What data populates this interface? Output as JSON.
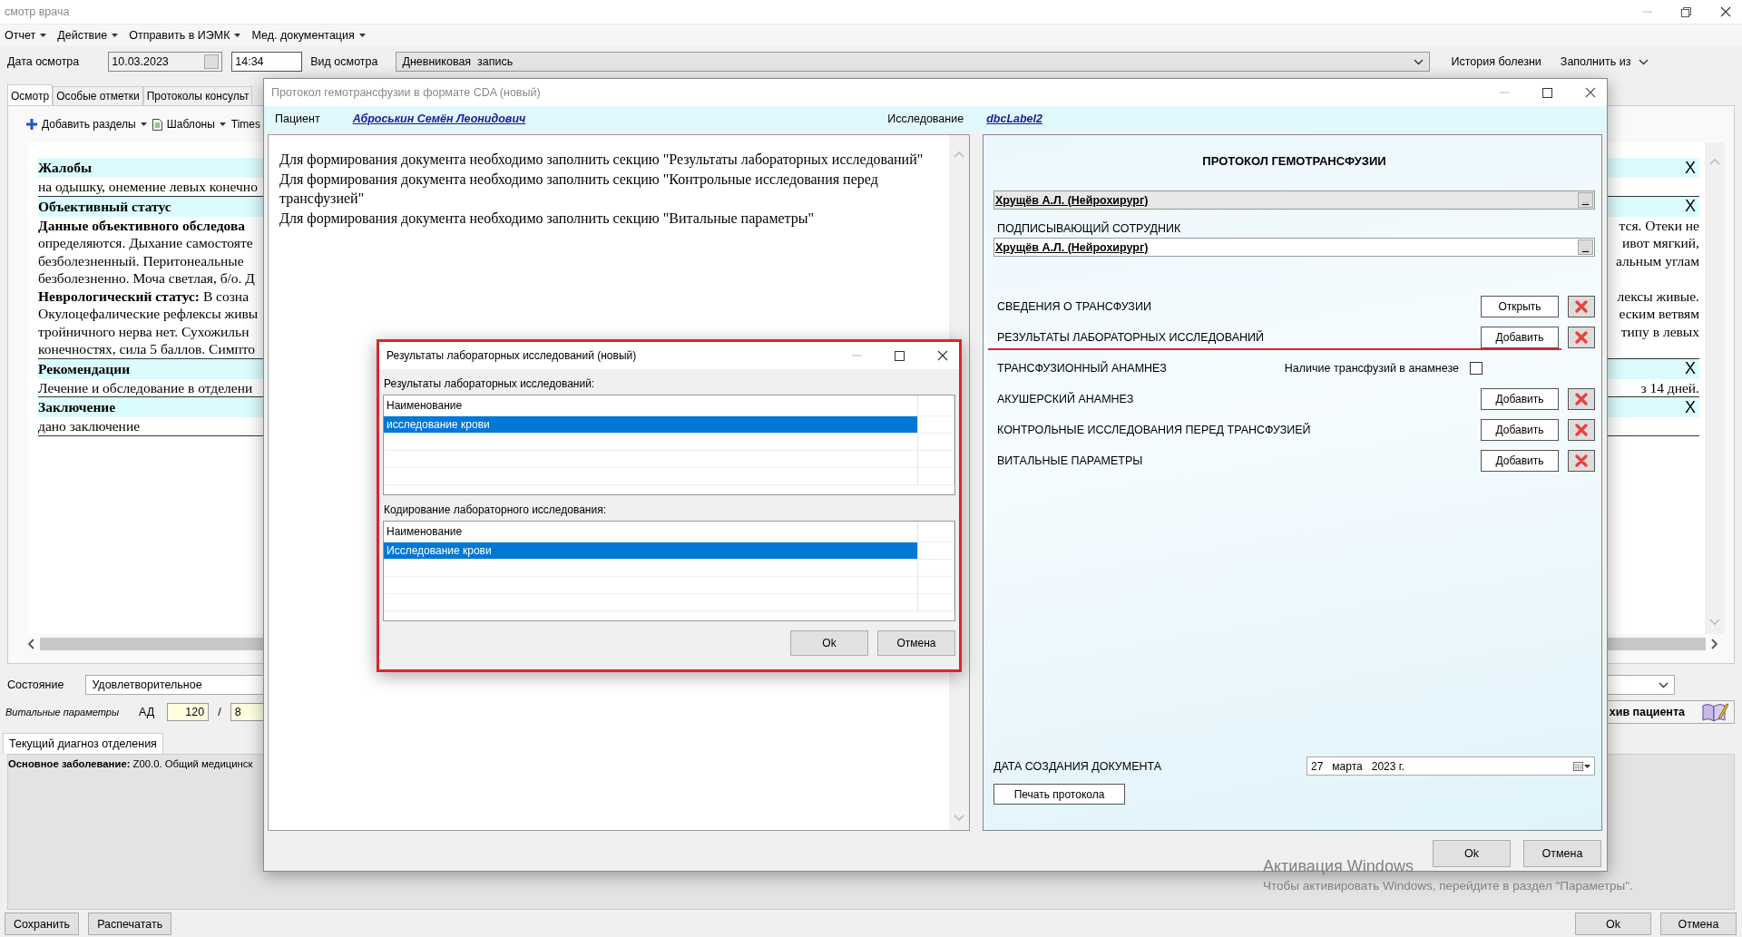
{
  "window": {
    "title": "смотр врача"
  },
  "menu": [
    {
      "label": "Отчет"
    },
    {
      "label": "Действие"
    },
    {
      "label": "Отправить в ИЭМК"
    },
    {
      "label": "Мед. документация"
    }
  ],
  "exam": {
    "date_label": "Дата осмотра",
    "date": "10.03.2023",
    "time": "14:34",
    "type_label": "Вид осмотра",
    "type": "Дневниковая  запись",
    "history_button": "История болезни",
    "fill_button": "Заполнить из"
  },
  "tabs": [
    {
      "label": "Осмотр",
      "selected": true
    },
    {
      "label": "Особые отметки",
      "selected": false
    },
    {
      "label": "Протоколы консульт",
      "selected": false
    }
  ],
  "toolbar": {
    "add_sections": "Добавить разделы",
    "templates": "Шаблоны",
    "font": "Times"
  },
  "document": {
    "sections": [
      {
        "title": "Жалобы",
        "remove": "X",
        "lines": [
          {
            "left": "на одышку, онемение левых конечно"
          }
        ]
      },
      {
        "title": "Объективный статус",
        "remove": "X",
        "lines": [
          {
            "left": "**Данные объективного обследова**",
            "right": "тся. Отеки не"
          },
          {
            "left": "определяются. Дыхание самостояте",
            "right": "ивот мягкий,"
          },
          {
            "left": "безболезненный. Перитонеальные",
            "right": "альным углам"
          },
          {
            "left": "безболезненно. Моча светлая, б/о. Д"
          },
          {
            "left": "**Неврологический статус:** В созна",
            "right": "лексы живые."
          },
          {
            "left": "Окулоцефалические рефлексы живы",
            "right": "еским ветвям"
          },
          {
            "left": "тройничного нерва нет. Сухожильн",
            "right": "типу в левых"
          },
          {
            "left": "конечностях, сила 5 баллов. Симпто"
          }
        ]
      },
      {
        "title": "Рекомендации",
        "remove": "X",
        "lines": [
          {
            "left": "Лечение и обследование в отделени",
            "right": "з 14 дней."
          }
        ]
      },
      {
        "title": "Заключение",
        "remove": "X",
        "lines": [
          {
            "left": "дано заключение"
          }
        ]
      }
    ]
  },
  "state": {
    "label": "Состояние",
    "value": "Удовлетворительное"
  },
  "vitals": {
    "label": "Витальные параметры",
    "bp_label": "АД",
    "systolic": "120",
    "separator": "/",
    "diastolic": "8",
    "archive_button": "хив пациента"
  },
  "diagnosis_tab": {
    "label": "Текущий диагноз отделения"
  },
  "diagnosis": "**Основное заболевание:** Z00.0. Общий медицинск",
  "footer_left": [
    "Сохранить",
    "Распечатать"
  ],
  "footer_right": [
    "Ok",
    "Отмена"
  ],
  "transfusion_dialog": {
    "title": "Протокол гемотрансфузии в формате CDA (новый)",
    "patient_label": "Пациент",
    "patient": "Аброськин Семён Леонидович",
    "study_label": "Исследование",
    "study": "dbcLabel2",
    "messages": [
      "Для формирования документа необходимо заполнить секцию \"Результаты лабораторных исследований\"",
      "Для формирования документа необходимо заполнить секцию \"Контрольные исследования перед трансфузией\"",
      "Для формирования документа необходимо заполнить секцию \"Витальные параметры\""
    ],
    "form_title": "ПРОТОКОЛ ГЕМОТРАНСФУЗИИ",
    "author": "Хрущёв А.Л. (Нейрохирург)",
    "author_browse": "...",
    "signer_label": "ПОДПИСЫВАЮЩИЙ СОТРУДНИК",
    "signer": "Хрущёв А.Л. (Нейрохирург)",
    "signer_browse": "...",
    "sections": [
      {
        "kind": "action",
        "label": "СВЕДЕНИЯ О ТРАНСФУЗИИ",
        "button": "Открыть",
        "underlined": false
      },
      {
        "kind": "action",
        "label": "РЕЗУЛЬТАТЫ ЛАБОРАТОРНЫХ ИССЛЕДОВАНИЙ",
        "button": "Добавить",
        "underlined": true
      },
      {
        "kind": "checkbox",
        "label": "ТРАНСФУЗИОННЫЙ АНАМНЕЗ",
        "option": "Наличие трансфузий в анамнезе",
        "checked": false
      },
      {
        "kind": "action",
        "label": "АКУШЕРСКИЙ АНАМНЕЗ",
        "button": "Добавить",
        "underlined": false
      },
      {
        "kind": "action",
        "label": "КОНТРОЛЬНЫЕ ИССЛЕДОВАНИЯ ПЕРЕД ТРАНСФУЗИЕЙ",
        "button": "Добавить",
        "underlined": false
      },
      {
        "kind": "action",
        "label": "ВИТАЛЬНЫЕ ПАРАМЕТРЫ",
        "button": "Добавить",
        "underlined": false
      }
    ],
    "date_label": "ДАТА СОЗДАНИЯ ДОКУМЕНТА",
    "date": "27   марта   2023 г.",
    "print_button": "Печать протокола",
    "ok": "Ok",
    "cancel": "Отмена"
  },
  "lab_dialog": {
    "title": "Результаты лабораторных исследований (новый)",
    "highlighted": true,
    "tables": [
      {
        "label": "Результаты лабораторных исследований:",
        "column": "Наименование",
        "rows": [
          {
            "name": "исследование крови",
            "selected": true
          }
        ]
      },
      {
        "label": "Кодирование лабораторного исследования:",
        "column": "Наименование",
        "rows": [
          {
            "name": "Исследование крови",
            "selected": true
          }
        ]
      }
    ],
    "ok": "Ok",
    "cancel": "Отмена"
  },
  "activation_notice": {
    "title": "Активация Windows",
    "text": "Чтобы активировать Windows, перейдите в раздел \"Параметры\"."
  }
}
